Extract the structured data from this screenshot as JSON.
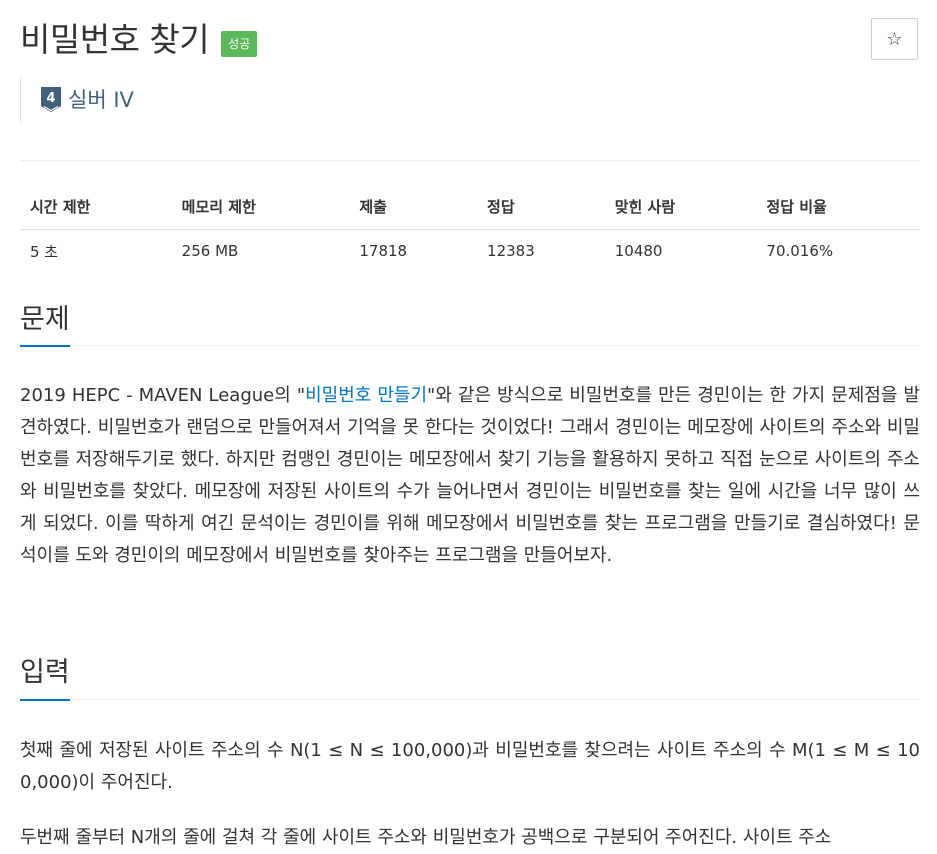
{
  "problem": {
    "title": "비밀번호 찾기",
    "badge": "성공",
    "tier_number": "4",
    "tier_label": "실버 IV",
    "star": "☆"
  },
  "info_table": {
    "headers": [
      "시간 제한",
      "메모리 제한",
      "제출",
      "정답",
      "맞힌 사람",
      "정답 비율"
    ],
    "values": [
      "5 초",
      "256 MB",
      "17818",
      "12383",
      "10480",
      "70.016%"
    ]
  },
  "sections": {
    "problem_title": "문제",
    "problem_text_before": "2019 HEPC - MAVEN League의 \"",
    "problem_link": "비밀번호 만들기",
    "problem_text_after": "\"와 같은 방식으로 비밀번호를 만든 경민이는 한 가지 문제점을 발견하였다. 비밀번호가 랜덤으로 만들어져서 기억을 못 한다는 것이었다! 그래서 경민이는 메모장에 사이트의 주소와 비밀번호를 저장해두기로 했다. 하지만 컴맹인 경민이는 메모장에서 찾기 기능을 활용하지 못하고 직접 눈으로 사이트의 주소와 비밀번호를 찾았다. 메모장에 저장된 사이트의 수가 늘어나면서 경민이는 비밀번호를 찾는 일에 시간을 너무 많이 쓰게 되었다. 이를 딱하게 여긴 문석이는 경민이를 위해 메모장에서 비밀번호를 찾는 프로그램을 만들기로 결심하였다! 문석이를 도와 경민이의 메모장에서 비밀번호를 찾아주는 프로그램을 만들어보자.",
    "input_title": "입력",
    "input_p1": "첫째 줄에 저장된 사이트 주소의 수 N(1 ≤ N ≤ 100,000)과 비밀번호를 찾으려는 사이트 주소의 수 M(1 ≤ M ≤ 100,000)이 주어진다.",
    "input_p2": "두번째 줄부터 N개의 줄에 걸쳐 각 줄에 사이트 주소와 비밀번호가 공백으로 구분되어 주어진다. 사이트 주소"
  }
}
